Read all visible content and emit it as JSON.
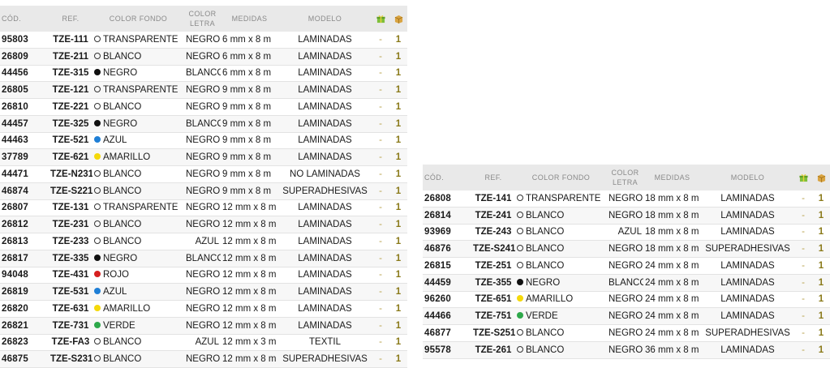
{
  "headers": {
    "cod": "CÓD.",
    "ref": "REF.",
    "fondo": "COLOR FONDO",
    "letra": "COLOR LETRA",
    "medidas": "MEDIDAS",
    "modelo": "MODELO"
  },
  "header_icons": [
    "gift-box-icon",
    "package-box-icon"
  ],
  "colors": {
    "negro": "#111111",
    "azul": "#1f7fd6",
    "amarillo": "#f5d90a",
    "rojo": "#d62020",
    "verde": "#2ea84a",
    "hollow": "#333333",
    "header_bg": "#e9e9e9",
    "qty": "#8a7a1a"
  },
  "tables": [
    {
      "rows": [
        {
          "cod": "95803",
          "ref": "TZE-111",
          "fondo": "TRANSPARENTE",
          "dot": "hollow",
          "letra": "NEGRO",
          "medidas": "6 mm x 8 m",
          "modelo": "LAMINADAS",
          "q1": "-",
          "q2": "1"
        },
        {
          "cod": "26809",
          "ref": "TZE-211",
          "fondo": "BLANCO",
          "dot": "hollow",
          "letra": "NEGRO",
          "medidas": "6 mm x 8 m",
          "modelo": "LAMINADAS",
          "q1": "-",
          "q2": "1"
        },
        {
          "cod": "44456",
          "ref": "TZE-315",
          "fondo": "NEGRO",
          "dot": "negro",
          "letra": "BLANCO",
          "medidas": "6 mm x 8 m",
          "modelo": "LAMINADAS",
          "q1": "-",
          "q2": "1"
        },
        {
          "cod": "26805",
          "ref": "TZE-121",
          "fondo": "TRANSPARENTE",
          "dot": "hollow",
          "letra": "NEGRO",
          "medidas": "9 mm x 8 m",
          "modelo": "LAMINADAS",
          "q1": "-",
          "q2": "1"
        },
        {
          "cod": "26810",
          "ref": "TZE-221",
          "fondo": "BLANCO",
          "dot": "hollow",
          "letra": "NEGRO",
          "medidas": "9 mm x 8 m",
          "modelo": "LAMINADAS",
          "q1": "-",
          "q2": "1"
        },
        {
          "cod": "44457",
          "ref": "TZE-325",
          "fondo": "NEGRO",
          "dot": "negro",
          "letra": "BLANCO",
          "medidas": "9 mm x 8 m",
          "modelo": "LAMINADAS",
          "q1": "-",
          "q2": "1"
        },
        {
          "cod": "44463",
          "ref": "TZE-521",
          "fondo": "AZUL",
          "dot": "azul",
          "letra": "NEGRO",
          "medidas": "9 mm x 8 m",
          "modelo": "LAMINADAS",
          "q1": "-",
          "q2": "1"
        },
        {
          "cod": "37789",
          "ref": "TZE-621",
          "fondo": "AMARILLO",
          "dot": "amarillo",
          "letra": "NEGRO",
          "medidas": "9 mm x 8 m",
          "modelo": "LAMINADAS",
          "q1": "-",
          "q2": "1"
        },
        {
          "cod": "44471",
          "ref": "TZE-N231",
          "fondo": "BLANCO",
          "dot": "hollow",
          "letra": "NEGRO",
          "medidas": "9 mm x 8 m",
          "modelo": "NO LAMINADAS",
          "q1": "-",
          "q2": "1"
        },
        {
          "cod": "46874",
          "ref": "TZE-S221",
          "fondo": "BLANCO",
          "dot": "hollow",
          "letra": "NEGRO",
          "medidas": "9 mm x 8 m",
          "modelo": "SUPERADHESIVAS",
          "q1": "-",
          "q2": "1"
        },
        {
          "cod": "26807",
          "ref": "TZE-131",
          "fondo": "TRANSPARENTE",
          "dot": "hollow",
          "letra": "NEGRO",
          "medidas": "12 mm x 8 m",
          "modelo": "LAMINADAS",
          "q1": "-",
          "q2": "1"
        },
        {
          "cod": "26812",
          "ref": "TZE-231",
          "fondo": "BLANCO",
          "dot": "hollow",
          "letra": "NEGRO",
          "medidas": "12 mm x 8 m",
          "modelo": "LAMINADAS",
          "q1": "-",
          "q2": "1"
        },
        {
          "cod": "26813",
          "ref": "TZE-233",
          "fondo": "BLANCO",
          "dot": "hollow",
          "letra": "AZUL",
          "medidas": "12 mm x 8 m",
          "modelo": "LAMINADAS",
          "q1": "-",
          "q2": "1"
        },
        {
          "cod": "26817",
          "ref": "TZE-335",
          "fondo": "NEGRO",
          "dot": "negro",
          "letra": "BLANCO",
          "medidas": "12 mm x 8 m",
          "modelo": "LAMINADAS",
          "q1": "-",
          "q2": "1"
        },
        {
          "cod": "94048",
          "ref": "TZE-431",
          "fondo": "ROJO",
          "dot": "rojo",
          "letra": "NEGRO",
          "medidas": "12 mm x 8 m",
          "modelo": "LAMINADAS",
          "q1": "-",
          "q2": "1"
        },
        {
          "cod": "26819",
          "ref": "TZE-531",
          "fondo": "AZUL",
          "dot": "azul",
          "letra": "NEGRO",
          "medidas": "12 mm x 8 m",
          "modelo": "LAMINADAS",
          "q1": "-",
          "q2": "1"
        },
        {
          "cod": "26820",
          "ref": "TZE-631",
          "fondo": "AMARILLO",
          "dot": "amarillo",
          "letra": "NEGRO",
          "medidas": "12 mm x 8 m",
          "modelo": "LAMINADAS",
          "q1": "-",
          "q2": "1"
        },
        {
          "cod": "26821",
          "ref": "TZE-731",
          "fondo": "VERDE",
          "dot": "verde",
          "letra": "NEGRO",
          "medidas": "12 mm x 8 m",
          "modelo": "LAMINADAS",
          "q1": "-",
          "q2": "1"
        },
        {
          "cod": "26823",
          "ref": "TZE-FA3",
          "fondo": "BLANCO",
          "dot": "hollow",
          "letra": "AZUL",
          "medidas": "12 mm x 3 m",
          "modelo": "TEXTIL",
          "q1": "-",
          "q2": "1"
        },
        {
          "cod": "46875",
          "ref": "TZE-S231",
          "fondo": "BLANCO",
          "dot": "hollow",
          "letra": "NEGRO",
          "medidas": "12 mm x 8 m",
          "modelo": "SUPERADHESIVAS",
          "q1": "-",
          "q2": "1"
        }
      ]
    },
    {
      "rows": [
        {
          "cod": "26808",
          "ref": "TZE-141",
          "fondo": "TRANSPARENTE",
          "dot": "hollow",
          "letra": "NEGRO",
          "medidas": "18 mm x 8 m",
          "modelo": "LAMINADAS",
          "q1": "-",
          "q2": "1"
        },
        {
          "cod": "26814",
          "ref": "TZE-241",
          "fondo": "BLANCO",
          "dot": "hollow",
          "letra": "NEGRO",
          "medidas": "18 mm x 8 m",
          "modelo": "LAMINADAS",
          "q1": "-",
          "q2": "1"
        },
        {
          "cod": "93969",
          "ref": "TZE-243",
          "fondo": "BLANCO",
          "dot": "hollow",
          "letra": "AZUL",
          "medidas": "18 mm x 8 m",
          "modelo": "LAMINADAS",
          "q1": "-",
          "q2": "1"
        },
        {
          "cod": "46876",
          "ref": "TZE-S241",
          "fondo": "BLANCO",
          "dot": "hollow",
          "letra": "NEGRO",
          "medidas": "18 mm x 8 m",
          "modelo": "SUPERADHESIVAS",
          "q1": "-",
          "q2": "1"
        },
        {
          "cod": "26815",
          "ref": "TZE-251",
          "fondo": "BLANCO",
          "dot": "hollow",
          "letra": "NEGRO",
          "medidas": "24 mm x 8 m",
          "modelo": "LAMINADAS",
          "q1": "-",
          "q2": "1"
        },
        {
          "cod": "44459",
          "ref": "TZE-355",
          "fondo": "NEGRO",
          "dot": "negro",
          "letra": "BLANCO",
          "medidas": "24 mm x 8 m",
          "modelo": "LAMINADAS",
          "q1": "-",
          "q2": "1"
        },
        {
          "cod": "96260",
          "ref": "TZE-651",
          "fondo": "AMARILLO",
          "dot": "amarillo",
          "letra": "NEGRO",
          "medidas": "24 mm x 8 m",
          "modelo": "LAMINADAS",
          "q1": "-",
          "q2": "1"
        },
        {
          "cod": "44466",
          "ref": "TZE-751",
          "fondo": "VERDE",
          "dot": "verde",
          "letra": "NEGRO",
          "medidas": "24 mm x 8 m",
          "modelo": "LAMINADAS",
          "q1": "-",
          "q2": "1"
        },
        {
          "cod": "46877",
          "ref": "TZE-S251",
          "fondo": "BLANCO",
          "dot": "hollow",
          "letra": "NEGRO",
          "medidas": "24 mm x 8 m",
          "modelo": "SUPERADHESIVAS",
          "q1": "-",
          "q2": "1"
        },
        {
          "cod": "95578",
          "ref": "TZE-261",
          "fondo": "BLANCO",
          "dot": "hollow",
          "letra": "NEGRO",
          "medidas": "36 mm x 8 m",
          "modelo": "LAMINADAS",
          "q1": "-",
          "q2": "1"
        }
      ]
    }
  ]
}
